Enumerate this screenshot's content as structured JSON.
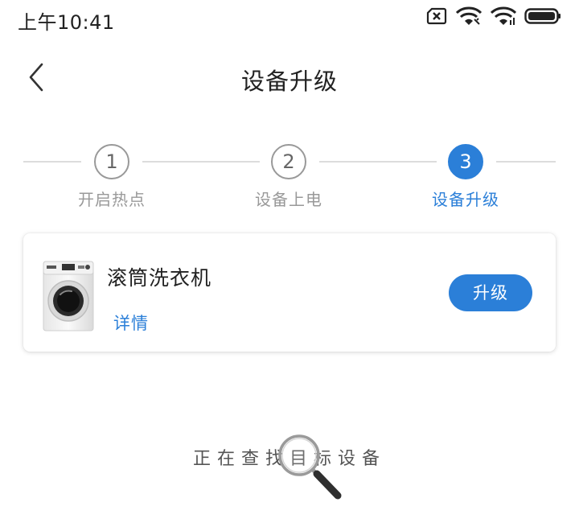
{
  "status_bar": {
    "time": "上午10:41",
    "icons": [
      "sim-disabled-icon",
      "wifi-calling-icon",
      "wifi-icon",
      "battery-icon"
    ]
  },
  "header": {
    "title": "设备升级",
    "back_icon": "chevron-left-icon"
  },
  "stepper": {
    "steps": [
      {
        "number": "1",
        "label": "开启热点",
        "active": false
      },
      {
        "number": "2",
        "label": "设备上电",
        "active": false
      },
      {
        "number": "3",
        "label": "设备升级",
        "active": true
      }
    ]
  },
  "device": {
    "name": "滚筒洗衣机",
    "details_label": "详情",
    "upgrade_label": "升级",
    "image_icon": "washing-machine-icon"
  },
  "search": {
    "status_text": "正在查找目标设备",
    "icon": "magnifier-icon"
  },
  "colors": {
    "accent": "#2b7fd8",
    "inactive": "#999999",
    "line": "#dcdcdc"
  }
}
